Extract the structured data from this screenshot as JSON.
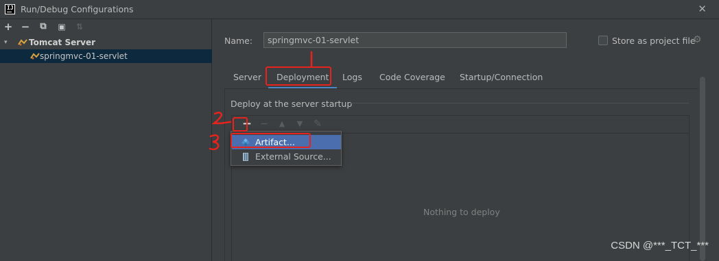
{
  "window": {
    "logo_text": "IJ",
    "title": "Run/Debug Configurations",
    "close_glyph": "✕"
  },
  "left_toolbar": {
    "add_glyph": "+",
    "remove_glyph": "−",
    "copy_glyph": "⧉",
    "folder_glyph": "▣",
    "sort_glyph": "⇅"
  },
  "tree": {
    "group_arrow": "▾",
    "group_label": "Tomcat Server",
    "child_label": "springmvc-01-servlet"
  },
  "form": {
    "name_label": "Name:",
    "name_value": "springmvc-01-servlet",
    "store_label": "Store as project file",
    "store_checked": false,
    "gear_glyph": "⚙"
  },
  "tabs": [
    {
      "label": "Server",
      "active": false
    },
    {
      "label": "Deployment",
      "active": true
    },
    {
      "label": "Logs",
      "active": false
    },
    {
      "label": "Code Coverage",
      "active": false
    },
    {
      "label": "Startup/Connection",
      "active": false
    }
  ],
  "deploy": {
    "section_title": "Deploy at the server startup",
    "add_glyph": "+",
    "remove_glyph": "−",
    "up_glyph": "▲",
    "down_glyph": "▼",
    "edit_glyph": "✎",
    "empty_text": "Nothing to deploy"
  },
  "popup": {
    "items": [
      {
        "label": "Artifact...",
        "icon": "artifact-icon"
      },
      {
        "label": "External Source...",
        "icon": "external-source-icon"
      }
    ]
  },
  "annotations": {
    "one": "1",
    "two": "2",
    "three": "3",
    "color": "#e8231d"
  },
  "watermark": "CSDN @***_TCT_***",
  "colors": {
    "background": "#3c3f41",
    "selection": "#0d293e",
    "popup_hover": "#4b6eaf",
    "tab_underline": "#4a88c7"
  }
}
